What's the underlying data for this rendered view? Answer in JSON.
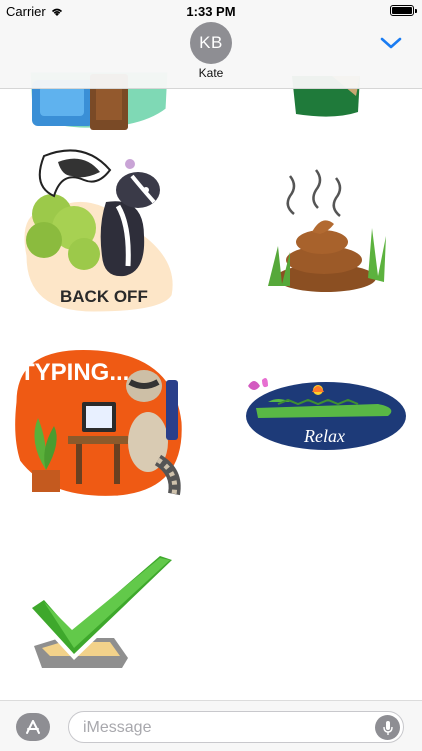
{
  "status_bar": {
    "carrier": "Carrier",
    "time": "1:33 PM"
  },
  "header": {
    "avatar_initials": "KB",
    "contact_name": "Kate",
    "chevron_icon": "chevron-down-icon"
  },
  "stickers": [
    {
      "name": "blue-couch-sticker",
      "text": ""
    },
    {
      "name": "green-box-sticker",
      "text": ""
    },
    {
      "name": "skunk-back-off-sticker",
      "text": "BACK OFF"
    },
    {
      "name": "poop-sticker",
      "text": ""
    },
    {
      "name": "raccoon-typing-sticker",
      "text": "TYPING..."
    },
    {
      "name": "crocodile-relax-sticker",
      "text": "Relax"
    },
    {
      "name": "checkmark-sticker",
      "text": ""
    }
  ],
  "compose": {
    "app_store_icon": "app-store-icon",
    "placeholder": "iMessage",
    "mic_icon": "microphone-icon"
  },
  "colors": {
    "accent": "#1a7cf2",
    "avatar_gray": "#8e8e93",
    "typing_orange": "#ef5a14",
    "relax_blue": "#1d3a78",
    "check_green": "#3ea82c"
  }
}
